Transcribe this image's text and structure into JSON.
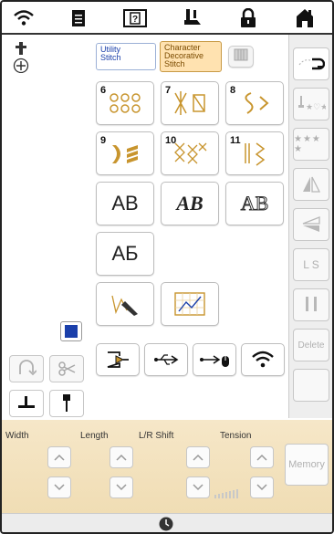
{
  "topbar": {
    "icons": [
      "wifi-icon",
      "document-icon",
      "help-icon",
      "presser-foot-icon",
      "lock-icon",
      "home-icon"
    ]
  },
  "tabs": {
    "utility": "Utility\nStitch",
    "character": "Character\nDecorative\nStitch"
  },
  "stitch_buttons": [
    {
      "num": "6"
    },
    {
      "num": "7"
    },
    {
      "num": "8"
    },
    {
      "num": "9"
    },
    {
      "num": "10"
    },
    {
      "num": "11"
    }
  ],
  "font_buttons": {
    "ab1": "AB",
    "ab2": "AB",
    "ab3": "AB",
    "cyrillic": "АБ"
  },
  "right_panel": {
    "ls": "L S",
    "delete": "Delete"
  },
  "settings": {
    "width": "Width",
    "length": "Length",
    "lr_shift": "L/R Shift",
    "tension": "Tension",
    "memory": "Memory"
  },
  "colors": {
    "accent_tab": "#ffe2b0",
    "blue_tab": "#1a3faa",
    "settings_bg": "#f3e2bf"
  }
}
